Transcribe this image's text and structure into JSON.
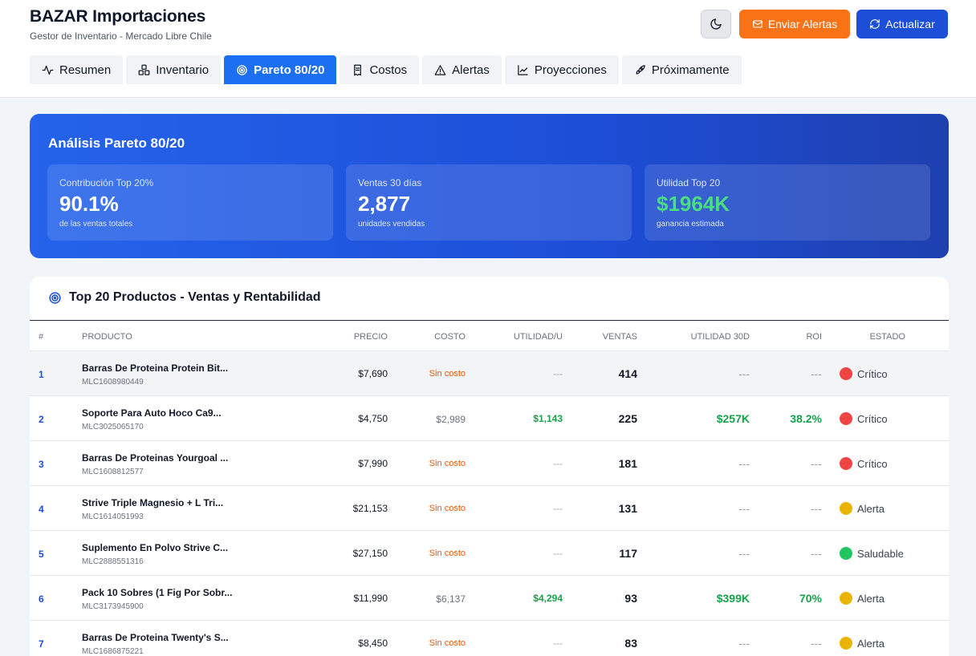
{
  "app": {
    "title": "BAZAR Importaciones",
    "subtitle": "Gestor de Inventario - Mercado Libre Chile"
  },
  "toolbar": {
    "alerts_label": "Enviar Alertas",
    "refresh_label": "Actualizar",
    "theme_icon": "moon-icon"
  },
  "tabs": [
    {
      "label": "Resumen",
      "icon": "activity-icon",
      "active": false
    },
    {
      "label": "Inventario",
      "icon": "boxes-icon",
      "active": false
    },
    {
      "label": "Pareto 80/20",
      "icon": "target-icon",
      "active": true
    },
    {
      "label": "Costos",
      "icon": "receipt-icon",
      "active": false
    },
    {
      "label": "Alertas",
      "icon": "warning-icon",
      "active": false
    },
    {
      "label": "Proyecciones",
      "icon": "chart-line-icon",
      "active": false
    },
    {
      "label": "Próximamente",
      "icon": "rocket-icon",
      "active": false
    }
  ],
  "pareto": {
    "title": "Análisis Pareto 80/20",
    "kpis": [
      {
        "label": "Contribución Top 20%",
        "value": "90.1%",
        "sub": "de las ventas totales"
      },
      {
        "label": "Ventas 30 días",
        "value": "2,877",
        "sub": "unidades vendidas"
      },
      {
        "label": "Utilidad Top 20",
        "value": "$1964K",
        "sub": "ganancia estimada"
      }
    ]
  },
  "top_table": {
    "title": "Top 20 Productos - Ventas y Rentabilidad",
    "headers": [
      "#",
      "PRODUCTO",
      "PRECIO",
      "COSTO",
      "UTILIDAD/U",
      "VENTAS",
      "UTILIDAD 30D",
      "ROI",
      "ESTADO"
    ],
    "rows": [
      {
        "num": "1",
        "name": "Barras De Proteina Protein Bit...",
        "id": "MLC1608980449",
        "price": "$7,690",
        "cost": "Sin costo",
        "util": "---",
        "sales": "414",
        "util30": "---",
        "roi": "---",
        "status": "Crítico"
      },
      {
        "num": "2",
        "name": "Soporte Para Auto Hoco Ca9...",
        "id": "MLC3025065170",
        "price": "$4,750",
        "cost": "$2,989",
        "util": "$1,143",
        "sales": "225",
        "util30": "$257K",
        "roi": "38.2%",
        "status": "Crítico"
      },
      {
        "num": "3",
        "name": "Barras De Proteinas Yourgoal ...",
        "id": "MLC1608812577",
        "price": "$7,990",
        "cost": "Sin costo",
        "util": "---",
        "sales": "181",
        "util30": "---",
        "roi": "---",
        "status": "Crítico"
      },
      {
        "num": "4",
        "name": "Strive Triple Magnesio + L Tri...",
        "id": "MLC1614051993",
        "price": "$21,153",
        "cost": "Sin costo",
        "util": "---",
        "sales": "131",
        "util30": "---",
        "roi": "---",
        "status": "Alerta"
      },
      {
        "num": "5",
        "name": "Suplemento En Polvo Strive C...",
        "id": "MLC2888551316",
        "price": "$27,150",
        "cost": "Sin costo",
        "util": "---",
        "sales": "117",
        "util30": "---",
        "roi": "---",
        "status": "Saludable"
      },
      {
        "num": "6",
        "name": "Pack 10 Sobres (1 Fig Por Sobr...",
        "id": "MLC3173945900",
        "price": "$11,990",
        "cost": "$6,137",
        "util": "$4,294",
        "sales": "93",
        "util30": "$399K",
        "roi": "70%",
        "status": "Alerta"
      },
      {
        "num": "7",
        "name": "Barras De Proteina Twenty's S...",
        "id": "MLC1686875221",
        "price": "$8,450",
        "cost": "Sin costo",
        "util": "---",
        "sales": "83",
        "util30": "---",
        "roi": "---",
        "status": "Alerta"
      }
    ]
  },
  "colors": {
    "primary": "#1d6ff2",
    "orange": "#f97316",
    "green": "#16a34a",
    "critical": "#ef4444",
    "warning": "#eab308",
    "healthy": "#22c55e"
  }
}
